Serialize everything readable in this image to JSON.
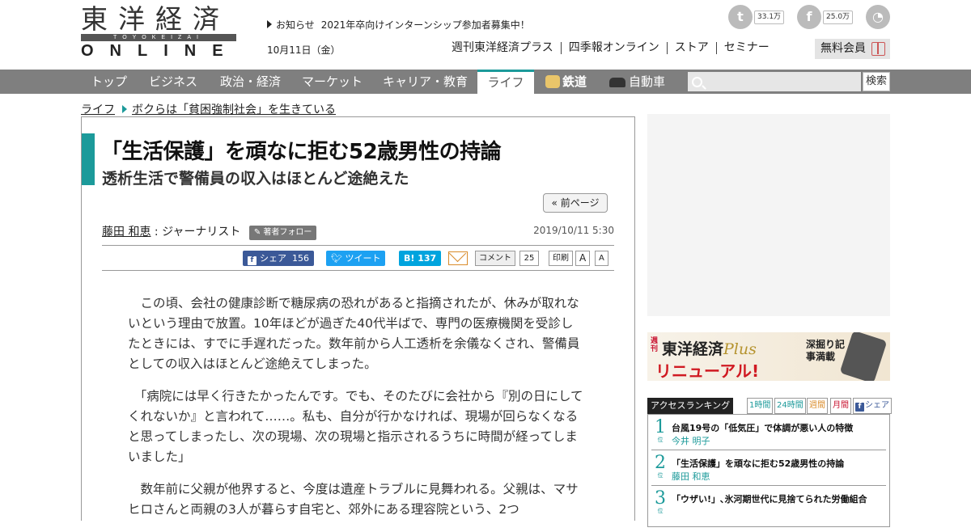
{
  "header": {
    "logo": {
      "top": "東洋経済",
      "bar": "TOYOKEIZAI",
      "bottom": "ONLINE"
    },
    "notice": {
      "label": "お知らせ",
      "text": "2021年卒向けインターンシップ参加者募集中！"
    },
    "date": "10月11日（金）",
    "links": [
      "週刊東洋経済プラス",
      "四季報オンライン",
      "ストア",
      "セミナー"
    ],
    "member": "無料会員",
    "social": [
      {
        "name": "twitter",
        "icon": "twitter-icon",
        "glyph": "t",
        "count": "33.1万",
        "color": "#bbbbbb"
      },
      {
        "name": "facebook",
        "icon": "facebook-icon",
        "glyph": "f",
        "count": "25.0万",
        "color": "#bbbbbb"
      },
      {
        "name": "rss",
        "icon": "rss-icon",
        "glyph": "◔",
        "count": "",
        "color": "#bbbbbb"
      }
    ]
  },
  "nav": {
    "items": [
      "トップ",
      "ビジネス",
      "政治・経済",
      "マーケット",
      "キャリア・教育",
      "ライフ",
      "鉄道",
      "自動車"
    ],
    "active": "ライフ",
    "search_button": "検索",
    "search_placeholder": ""
  },
  "breadcrumb": [
    "ライフ",
    "ボクらは「貧困強制社会」を生きている"
  ],
  "article": {
    "title": "「生活保護」を頑なに拒む52歳男性の持論",
    "subtitle": "透析生活で警備員の収入はほとんど途絶えた",
    "prev": "« 前ページ",
    "author": "藤田 和恵",
    "role": ": ジャーナリスト",
    "follow": "著者フォロー",
    "published": "2019/10/11 5:30",
    "share": {
      "fb_label": "シェア",
      "fb_count": "156",
      "tweet": "ツイート",
      "hatena_label": "B!",
      "hatena_count": "137",
      "comment": "コメント",
      "comment_count": "25",
      "print": "印刷",
      "font_large": "A",
      "font_small": "A"
    },
    "paragraphs": [
      "この頃、会社の健康診断で糖尿病の恐れがあると指摘されたが、休みが取れないという理由で放置。10年ほどが過ぎた40代半ばで、専門の医療機関を受診したときには、すでに手遅れだった。数年前から人工透析を余儀なくされ、警備員としての収入はほとんど途絶えてしまった。",
      "「病院には早く行きたかったんです。でも、そのたびに会社から『別の日にしてくれないか』と言われて……。私も、自分が行かなければ、現場が回らなくなると思ってしまったし、次の現場、次の現場と指示されるうちに時間が経ってしまいました」",
      "数年前に父親が他界すると、今度は遺産トラブルに見舞われる。父親は、マサヒロさんと両親の3人が暮らす自宅と、郊外にある理容院という、2つ"
    ]
  },
  "banner": {
    "weekly": "週刊",
    "title": "東洋経済",
    "plus": "Plus",
    "renewal": "リニューアル!",
    "side": "深掘り記事満載"
  },
  "ranking": {
    "title": "アクセスランキング",
    "tabs": [
      "1時間",
      "24時間",
      "週間",
      "月間",
      "シェア"
    ],
    "items": [
      {
        "rank": "1",
        "suffix": "位",
        "title": "台風19号の「低気圧」で体調が悪い人の特徴",
        "author": "今井 明子"
      },
      {
        "rank": "2",
        "suffix": "位",
        "title": "「生活保護」を頑なに拒む52歳男性の持論",
        "author": "藤田 和恵"
      },
      {
        "rank": "3",
        "suffix": "位",
        "title": "「ウザい!」､氷河期世代に見捨てられた労働組合",
        "author": ""
      }
    ]
  },
  "colors": {
    "accent": "#1c9a9a",
    "nav_bg": "#7f7f7f",
    "facebook": "#3b5998",
    "twitter": "#1da1f2",
    "hatena": "#00a4de"
  }
}
